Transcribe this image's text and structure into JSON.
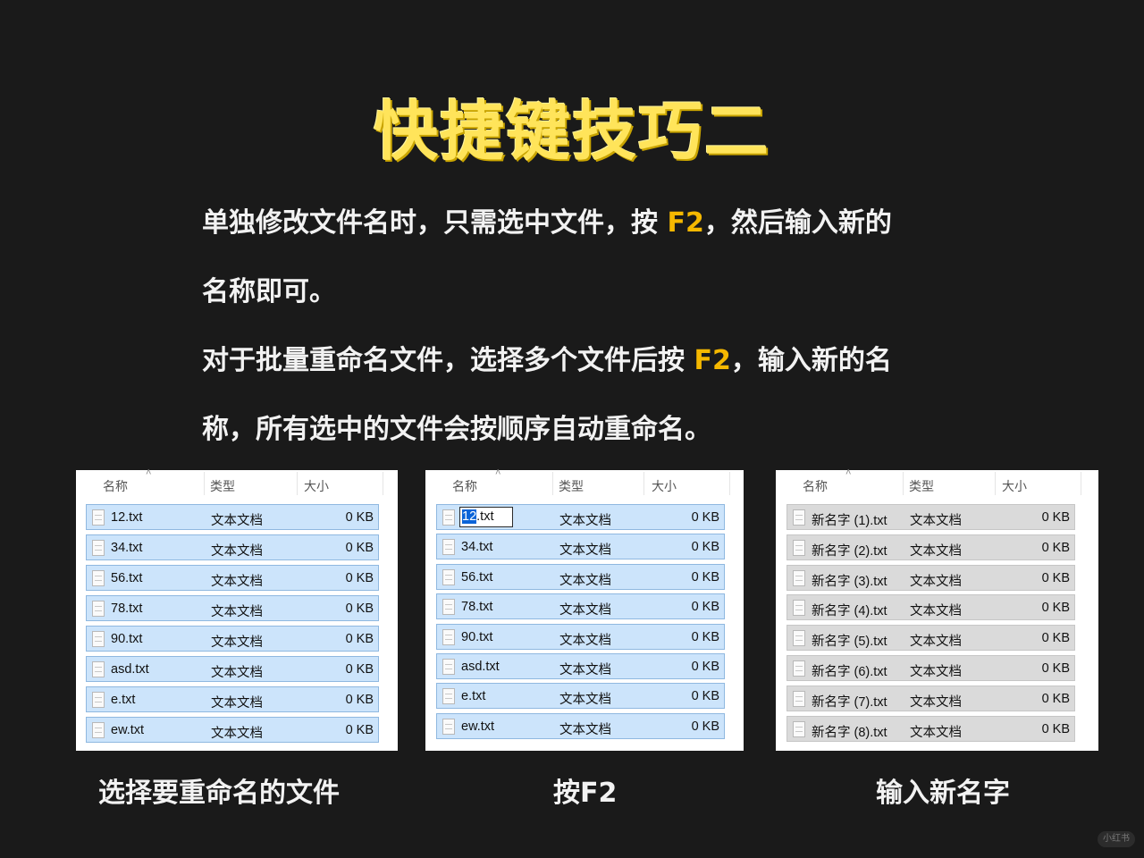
{
  "title": "快捷键技巧二",
  "paragraphs": {
    "p1_line1_a": "单独修改文件名时，只需选中文件，按 ",
    "p1_line1_key": "F2",
    "p1_line1_b": "，然后输入新的",
    "p1_line2": "名称即可。",
    "p2_line1_a": "对于批量重命名文件，选择多个文件后按 ",
    "p2_line1_key": "F2",
    "p2_line1_b": "，输入新的名",
    "p2_line2": "称，所有选中的文件会按顺序自动重命名。"
  },
  "key_color": "#f5b800",
  "title_color": "#ffe45a",
  "columns": {
    "name": "名称",
    "type": "类型",
    "size": "大小"
  },
  "panel1": {
    "caption": "选择要重命名的文件",
    "rows": [
      {
        "name": "12.txt",
        "type": "文本文档",
        "size": "0 KB"
      },
      {
        "name": "34.txt",
        "type": "文本文档",
        "size": "0 KB"
      },
      {
        "name": "56.txt",
        "type": "文本文档",
        "size": "0 KB"
      },
      {
        "name": "78.txt",
        "type": "文本文档",
        "size": "0 KB"
      },
      {
        "name": "90.txt",
        "type": "文本文档",
        "size": "0 KB"
      },
      {
        "name": "asd.txt",
        "type": "文本文档",
        "size": "0 KB"
      },
      {
        "name": "e.txt",
        "type": "文本文档",
        "size": "0 KB"
      },
      {
        "name": "ew.txt",
        "type": "文本文档",
        "size": "0 KB"
      }
    ]
  },
  "panel2": {
    "caption": "按F2",
    "edit_selected": "12",
    "edit_rest": ".txt",
    "rows": [
      {
        "name": "12.txt",
        "type": "文本文档",
        "size": "0 KB"
      },
      {
        "name": "34.txt",
        "type": "文本文档",
        "size": "0 KB"
      },
      {
        "name": "56.txt",
        "type": "文本文档",
        "size": "0 KB"
      },
      {
        "name": "78.txt",
        "type": "文本文档",
        "size": "0 KB"
      },
      {
        "name": "90.txt",
        "type": "文本文档",
        "size": "0 KB"
      },
      {
        "name": "asd.txt",
        "type": "文本文档",
        "size": "0 KB"
      },
      {
        "name": "e.txt",
        "type": "文本文档",
        "size": "0 KB"
      },
      {
        "name": "ew.txt",
        "type": "文本文档",
        "size": "0 KB"
      }
    ]
  },
  "panel3": {
    "caption": "输入新名字",
    "rows": [
      {
        "name": "新名字 (1).txt",
        "type": "文本文档",
        "size": "0 KB"
      },
      {
        "name": "新名字 (2).txt",
        "type": "文本文档",
        "size": "0 KB"
      },
      {
        "name": "新名字 (3).txt",
        "type": "文本文档",
        "size": "0 KB"
      },
      {
        "name": "新名字 (4).txt",
        "type": "文本文档",
        "size": "0 KB"
      },
      {
        "name": "新名字 (5).txt",
        "type": "文本文档",
        "size": "0 KB"
      },
      {
        "name": "新名字 (6).txt",
        "type": "文本文档",
        "size": "0 KB"
      },
      {
        "name": "新名字 (7).txt",
        "type": "文本文档",
        "size": "0 KB"
      },
      {
        "name": "新名字 (8).txt",
        "type": "文本文档",
        "size": "0 KB"
      }
    ]
  },
  "watermark": "小红书"
}
